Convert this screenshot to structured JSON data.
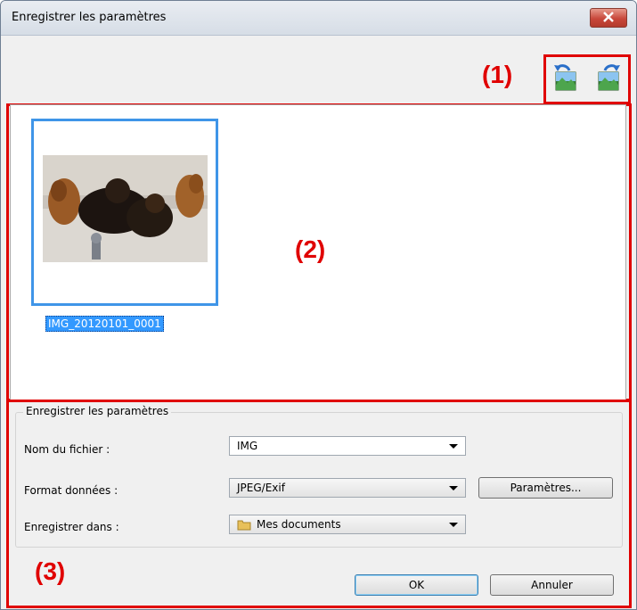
{
  "window": {
    "title": "Enregistrer les paramètres"
  },
  "callouts": {
    "one": "(1)",
    "two": "(2)",
    "three": "(3)"
  },
  "toolbar": {
    "rotate_left_icon": "rotate-left-icon",
    "rotate_right_icon": "rotate-right-icon"
  },
  "thumbnail": {
    "file_name": "IMG_20120101_0001"
  },
  "settings": {
    "group_title": "Enregistrer les paramètres",
    "file_name_label": "Nom du fichier :",
    "file_name_value": "IMG",
    "format_label": "Format données :",
    "format_value": "JPEG/Exif",
    "settings_button": "Paramètres...",
    "save_in_label": "Enregistrer dans :",
    "save_in_value": "Mes documents"
  },
  "buttons": {
    "ok": "OK",
    "cancel": "Annuler"
  },
  "colors": {
    "callout_red": "#e00000",
    "selection_blue": "#3399ff"
  }
}
